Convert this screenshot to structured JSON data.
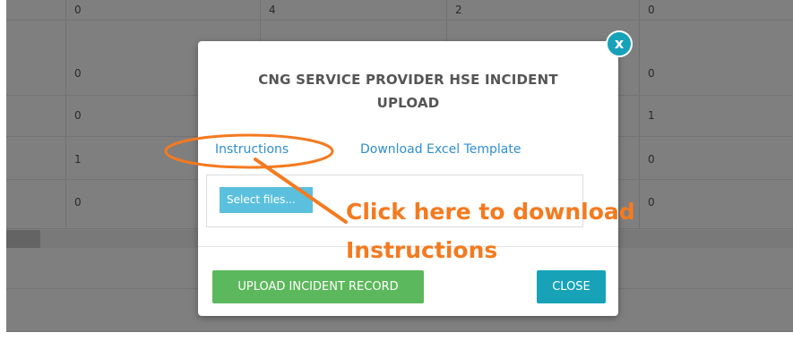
{
  "background": {
    "top_row": [
      "0",
      "4",
      "2",
      "0"
    ],
    "rows": [
      {
        "left": "0",
        "right": "0"
      },
      {
        "left": "0",
        "right": "1"
      },
      {
        "left": "1",
        "right": "0"
      },
      {
        "left": "0",
        "right": "0"
      }
    ]
  },
  "modal": {
    "title": "CNG SERVICE PROVIDER HSE INCIDENT UPLOAD",
    "instructions_link": "Instructions",
    "template_link": "Download Excel Template",
    "select_files_label": "Select files...",
    "upload_button": "UPLOAD INCIDENT RECORD",
    "close_button": "CLOSE",
    "close_x": "x"
  },
  "annotation": {
    "line1": "Click here to download",
    "line2": "Instructions"
  },
  "colors": {
    "link": "#2f8fd0",
    "upload_button": "#5cb85c",
    "close_button": "#17a2b8",
    "select_files": "#5bc0de",
    "annotation": "#f47a20"
  }
}
